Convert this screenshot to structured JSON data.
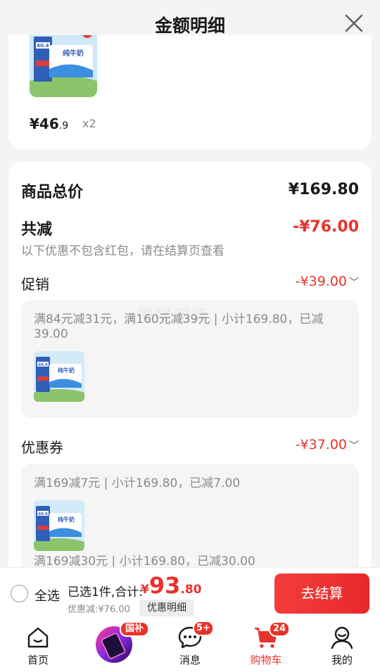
{
  "header": {
    "title": "金额明细"
  },
  "top_item": {
    "price_symbol": "¥",
    "price_int": "46",
    "price_dec": ".9",
    "quantity": "x2"
  },
  "summary": {
    "total_label": "商品总价",
    "total_value": "¥169.80",
    "reduce_label": "共减",
    "reduce_value": "-¥76.00",
    "note": "以下优惠不包含红包，请在结算页查看"
  },
  "promotion": {
    "label": "促销",
    "value": "-¥39.00",
    "detail": "满84元减31元，满160元减39元 | 小计169.80，已减39.00",
    "watermark": "慢慢阅读"
  },
  "coupon": {
    "label": "优惠券",
    "value": "-¥37.00",
    "detail1": "满169减7元 | 小计169.80，已减7.00",
    "detail2": "满169减30元 | 小计169.80，已减30.00"
  },
  "product_image": {
    "badge_text": "60.4",
    "brand_text": "纯牛奶"
  },
  "checkout": {
    "select_all": "全选",
    "selected_summary": "已选1件,合计:",
    "total_symbol": "¥",
    "total_int": "93",
    "total_dec": ".80",
    "discount_note": "优惠减:¥76.00",
    "detail_tag": "优惠明细",
    "button": "去结算"
  },
  "tabbar": {
    "items": [
      {
        "label": "首页",
        "icon": "home-icon"
      },
      {
        "label": "",
        "icon": "subsidy-icon",
        "badge": "国补"
      },
      {
        "label": "消息",
        "icon": "message-icon",
        "badge": "5+"
      },
      {
        "label": "购物车",
        "icon": "cart-icon",
        "badge": "24",
        "active": true
      },
      {
        "label": "我的",
        "icon": "profile-icon"
      }
    ]
  },
  "colors": {
    "accent": "#e8332b",
    "background": "#f4f4f4"
  }
}
